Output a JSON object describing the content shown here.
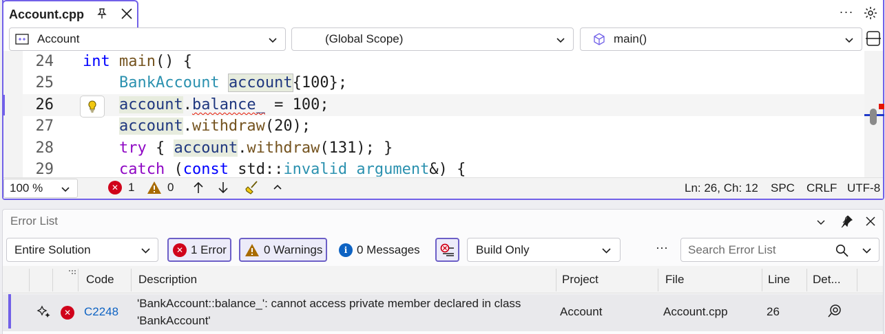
{
  "editor": {
    "tab_title": "Account.cpp",
    "nav_project": "Account",
    "nav_scope": "(Global Scope)",
    "nav_member": "main()",
    "lines": [
      {
        "num": "24"
      },
      {
        "num": "25"
      },
      {
        "num": "26"
      },
      {
        "num": "27"
      },
      {
        "num": "28"
      },
      {
        "num": "29"
      }
    ],
    "code": {
      "l24_kw": "int",
      "l24_fn": "main",
      "l24_rest": "() {",
      "l25_type": "BankAccount",
      "l25_var": "account",
      "l25_rest": "{100};",
      "l26_var": "account",
      "l26_dot": ".",
      "l26_member": "balance_",
      "l26_rest": " = 100;",
      "l27_var": "account",
      "l27_dot": ".",
      "l27_fn": "withdraw",
      "l27_rest": "(20);",
      "l28_kw": "try",
      "l28_open": " { ",
      "l28_var": "account",
      "l28_dot": ".",
      "l28_fn": "withdraw",
      "l28_rest": "(131); }",
      "l29_kw": "catch",
      "l29_open": " (",
      "l29_kw2": "const",
      "l29_ns": " std::",
      "l29_type": "invalid_argument",
      "l29_rest": "&) {"
    },
    "status": {
      "zoom": "100 %",
      "errors": "1",
      "warnings": "0",
      "position": "Ln: 26, Ch: 12",
      "indent": "SPC",
      "line_ending": "CRLF",
      "encoding": "UTF-8"
    }
  },
  "error_list": {
    "title": "Error List",
    "scope": "Entire Solution",
    "errors_label": "1 Error",
    "warnings_label": "0 Warnings",
    "messages_label": "0 Messages",
    "build_filter": "Build Only",
    "search_placeholder": "Search Error List",
    "columns": [
      "Code",
      "Description",
      "Project",
      "File",
      "Line",
      "Det..."
    ],
    "rows": [
      {
        "code": "C2248",
        "description_1": "'BankAccount::balance_': cannot access private member declared in class",
        "description_2": "'BankAccount'",
        "project": "Account",
        "file": "Account.cpp",
        "line": "26"
      }
    ]
  },
  "colors": {
    "accent": "#7160e8",
    "error": "#d0021b",
    "warning": "#a86b00",
    "info": "#0e63c3"
  }
}
